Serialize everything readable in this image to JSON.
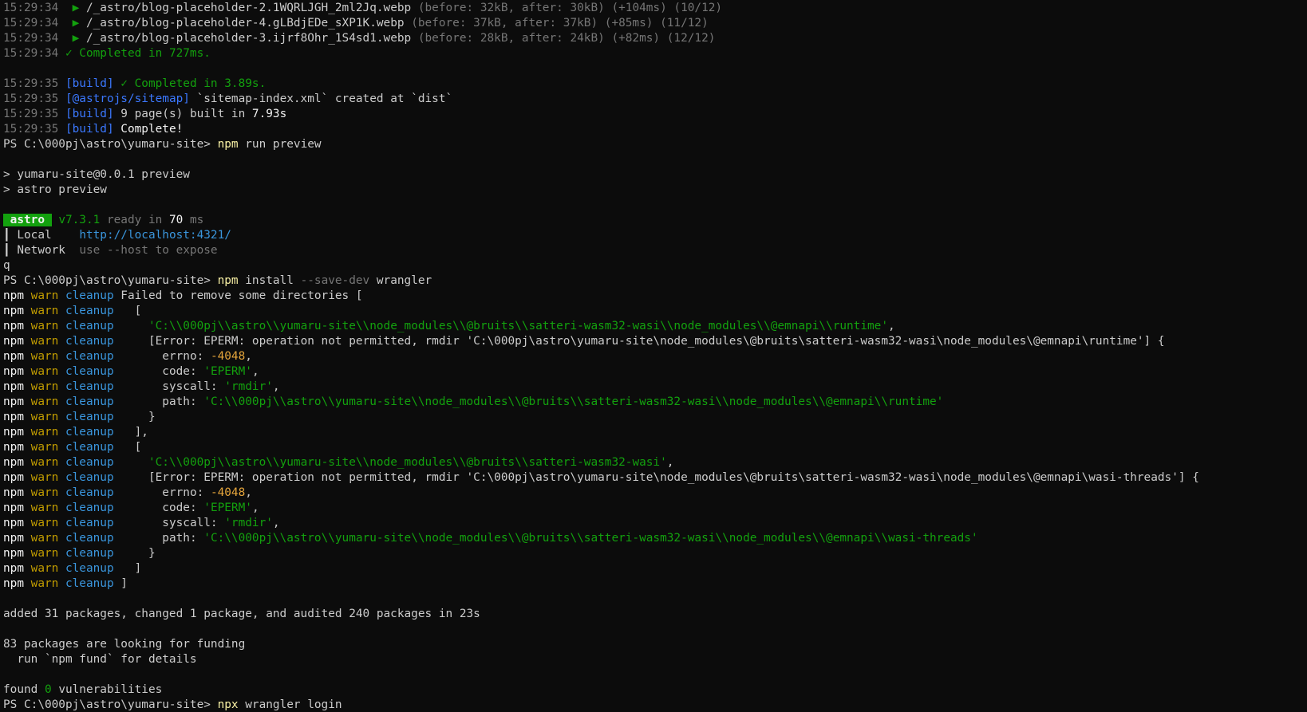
{
  "window": {
    "title": "PowerShell"
  },
  "colors": {
    "background": "#0c0c0c",
    "text": "#cccccc",
    "green": "#13a10e",
    "blue": "#3b78ff",
    "warn": "#c19c00",
    "dim": "#767676"
  },
  "lines": [
    [
      [
        "dim",
        "15:29:34 "
      ],
      [
        "green",
        " ▶ "
      ],
      [
        "default",
        "/_astro/blog-placeholder-2.1WQRLJGH_2ml2Jq.webp "
      ],
      [
        "dim",
        "(before: 32kB, after: 30kB) (+104ms) (10/12)"
      ]
    ],
    [
      [
        "dim",
        "15:29:34 "
      ],
      [
        "green",
        " ▶ "
      ],
      [
        "default",
        "/_astro/blog-placeholder-4.gLBdjEDe_sXP1K.webp "
      ],
      [
        "dim",
        "(before: 37kB, after: 37kB) (+85ms) (11/12)"
      ]
    ],
    [
      [
        "dim",
        "15:29:34 "
      ],
      [
        "green",
        " ▶ "
      ],
      [
        "default",
        "/_astro/blog-placeholder-3.ijrf8Ohr_1S4sd1.webp "
      ],
      [
        "dim",
        "(before: 28kB, after: 24kB) (+82ms) (12/12)"
      ]
    ],
    [
      [
        "dim",
        "15:29:34 "
      ],
      [
        "green",
        "✓ Completed in 727ms."
      ]
    ],
    [],
    [
      [
        "dim",
        "15:29:35 "
      ],
      [
        "blue",
        "[build]"
      ],
      [
        "green",
        " ✓ Completed in 3.89s."
      ]
    ],
    [
      [
        "dim",
        "15:29:35 "
      ],
      [
        "blue",
        "[@astrojs/sitemap]"
      ],
      [
        "default",
        " `sitemap-index.xml` created at `dist`"
      ]
    ],
    [
      [
        "dim",
        "15:29:35 "
      ],
      [
        "blue",
        "[build]"
      ],
      [
        "default",
        " 9 page(s) built in "
      ],
      [
        "bright",
        "7.93s"
      ]
    ],
    [
      [
        "dim",
        "15:29:35 "
      ],
      [
        "blue",
        "[build]"
      ],
      [
        "bright",
        " Complete!"
      ]
    ],
    [
      [
        "default",
        "PS C:\\000pj\\astro\\yumaru-site> "
      ],
      [
        "yellow",
        "npm"
      ],
      [
        "default",
        " run preview"
      ]
    ],
    [],
    [
      [
        "default",
        "> yumaru-site@0.0.1 preview"
      ]
    ],
    [
      [
        "default",
        "> astro preview"
      ]
    ],
    [],
    [
      [
        "badge",
        " astro "
      ],
      [
        "green",
        " v7.3.1"
      ],
      [
        "dim",
        " ready in "
      ],
      [
        "bright",
        "70"
      ],
      [
        "dim",
        " ms"
      ]
    ],
    [
      [
        "bar",
        "┃ "
      ],
      [
        "default",
        "Local    "
      ],
      [
        "cyan",
        "http://localhost:4321/"
      ]
    ],
    [
      [
        "bar",
        "┃ "
      ],
      [
        "default",
        "Network  "
      ],
      [
        "dim",
        "use --host to expose"
      ]
    ],
    [
      [
        "default",
        "q"
      ]
    ],
    [
      [
        "default",
        "PS C:\\000pj\\astro\\yumaru-site> "
      ],
      [
        "yellow",
        "npm"
      ],
      [
        "default",
        " install "
      ],
      [
        "dim",
        "--save-dev"
      ],
      [
        "default",
        " wrangler"
      ]
    ],
    [
      [
        "bright",
        "npm "
      ],
      [
        "warn",
        "warn "
      ],
      [
        "cyan",
        "cleanup"
      ],
      [
        "default",
        " Failed to remove some directories ["
      ]
    ],
    [
      [
        "bright",
        "npm "
      ],
      [
        "warn",
        "warn "
      ],
      [
        "cyan",
        "cleanup"
      ],
      [
        "default",
        "   ["
      ]
    ],
    [
      [
        "bright",
        "npm "
      ],
      [
        "warn",
        "warn "
      ],
      [
        "cyan",
        "cleanup"
      ],
      [
        "default",
        "     "
      ],
      [
        "green",
        "'C:\\\\000pj\\\\astro\\\\yumaru-site\\\\node_modules\\\\@bruits\\\\satteri-wasm32-wasi\\\\node_modules\\\\@emnapi\\\\runtime'"
      ],
      [
        "default",
        ","
      ]
    ],
    [
      [
        "bright",
        "npm "
      ],
      [
        "warn",
        "warn "
      ],
      [
        "cyan",
        "cleanup"
      ],
      [
        "default",
        "     [Error: EPERM: operation not permitted, rmdir 'C:\\000pj\\astro\\yumaru-site\\node_modules\\@bruits\\satteri-wasm32-wasi\\node_modules\\@emnapi\\runtime'] {"
      ]
    ],
    [
      [
        "bright",
        "npm "
      ],
      [
        "warn",
        "warn "
      ],
      [
        "cyan",
        "cleanup"
      ],
      [
        "default",
        "       errno: "
      ],
      [
        "orange",
        "-4048"
      ],
      [
        "default",
        ","
      ]
    ],
    [
      [
        "bright",
        "npm "
      ],
      [
        "warn",
        "warn "
      ],
      [
        "cyan",
        "cleanup"
      ],
      [
        "default",
        "       code: "
      ],
      [
        "green",
        "'EPERM'"
      ],
      [
        "default",
        ","
      ]
    ],
    [
      [
        "bright",
        "npm "
      ],
      [
        "warn",
        "warn "
      ],
      [
        "cyan",
        "cleanup"
      ],
      [
        "default",
        "       syscall: "
      ],
      [
        "green",
        "'rmdir'"
      ],
      [
        "default",
        ","
      ]
    ],
    [
      [
        "bright",
        "npm "
      ],
      [
        "warn",
        "warn "
      ],
      [
        "cyan",
        "cleanup"
      ],
      [
        "default",
        "       path: "
      ],
      [
        "green",
        "'C:\\\\000pj\\\\astro\\\\yumaru-site\\\\node_modules\\\\@bruits\\\\satteri-wasm32-wasi\\\\node_modules\\\\@emnapi\\\\runtime'"
      ]
    ],
    [
      [
        "bright",
        "npm "
      ],
      [
        "warn",
        "warn "
      ],
      [
        "cyan",
        "cleanup"
      ],
      [
        "default",
        "     }"
      ]
    ],
    [
      [
        "bright",
        "npm "
      ],
      [
        "warn",
        "warn "
      ],
      [
        "cyan",
        "cleanup"
      ],
      [
        "default",
        "   ],"
      ]
    ],
    [
      [
        "bright",
        "npm "
      ],
      [
        "warn",
        "warn "
      ],
      [
        "cyan",
        "cleanup"
      ],
      [
        "default",
        "   ["
      ]
    ],
    [
      [
        "bright",
        "npm "
      ],
      [
        "warn",
        "warn "
      ],
      [
        "cyan",
        "cleanup"
      ],
      [
        "default",
        "     "
      ],
      [
        "green",
        "'C:\\\\000pj\\\\astro\\\\yumaru-site\\\\node_modules\\\\@bruits\\\\satteri-wasm32-wasi'"
      ],
      [
        "default",
        ","
      ]
    ],
    [
      [
        "bright",
        "npm "
      ],
      [
        "warn",
        "warn "
      ],
      [
        "cyan",
        "cleanup"
      ],
      [
        "default",
        "     [Error: EPERM: operation not permitted, rmdir 'C:\\000pj\\astro\\yumaru-site\\node_modules\\@bruits\\satteri-wasm32-wasi\\node_modules\\@emnapi\\wasi-threads'] {"
      ]
    ],
    [
      [
        "bright",
        "npm "
      ],
      [
        "warn",
        "warn "
      ],
      [
        "cyan",
        "cleanup"
      ],
      [
        "default",
        "       errno: "
      ],
      [
        "orange",
        "-4048"
      ],
      [
        "default",
        ","
      ]
    ],
    [
      [
        "bright",
        "npm "
      ],
      [
        "warn",
        "warn "
      ],
      [
        "cyan",
        "cleanup"
      ],
      [
        "default",
        "       code: "
      ],
      [
        "green",
        "'EPERM'"
      ],
      [
        "default",
        ","
      ]
    ],
    [
      [
        "bright",
        "npm "
      ],
      [
        "warn",
        "warn "
      ],
      [
        "cyan",
        "cleanup"
      ],
      [
        "default",
        "       syscall: "
      ],
      [
        "green",
        "'rmdir'"
      ],
      [
        "default",
        ","
      ]
    ],
    [
      [
        "bright",
        "npm "
      ],
      [
        "warn",
        "warn "
      ],
      [
        "cyan",
        "cleanup"
      ],
      [
        "default",
        "       path: "
      ],
      [
        "green",
        "'C:\\\\000pj\\\\astro\\\\yumaru-site\\\\node_modules\\\\@bruits\\\\satteri-wasm32-wasi\\\\node_modules\\\\@emnapi\\\\wasi-threads'"
      ]
    ],
    [
      [
        "bright",
        "npm "
      ],
      [
        "warn",
        "warn "
      ],
      [
        "cyan",
        "cleanup"
      ],
      [
        "default",
        "     }"
      ]
    ],
    [
      [
        "bright",
        "npm "
      ],
      [
        "warn",
        "warn "
      ],
      [
        "cyan",
        "cleanup"
      ],
      [
        "default",
        "   ]"
      ]
    ],
    [
      [
        "bright",
        "npm "
      ],
      [
        "warn",
        "warn "
      ],
      [
        "cyan",
        "cleanup"
      ],
      [
        "default",
        " ]"
      ]
    ],
    [],
    [
      [
        "default",
        "added 31 packages, changed 1 package, and audited 240 packages in 23s"
      ]
    ],
    [],
    [
      [
        "default",
        "83 packages are looking for funding"
      ]
    ],
    [
      [
        "default",
        "  run `npm fund` for details"
      ]
    ],
    [],
    [
      [
        "default",
        "found "
      ],
      [
        "green",
        "0"
      ],
      [
        "default",
        " vulnerabilities"
      ]
    ],
    [
      [
        "default",
        "PS C:\\000pj\\astro\\yumaru-site> "
      ],
      [
        "yellow",
        "npx"
      ],
      [
        "default",
        " wrangler login"
      ]
    ]
  ]
}
